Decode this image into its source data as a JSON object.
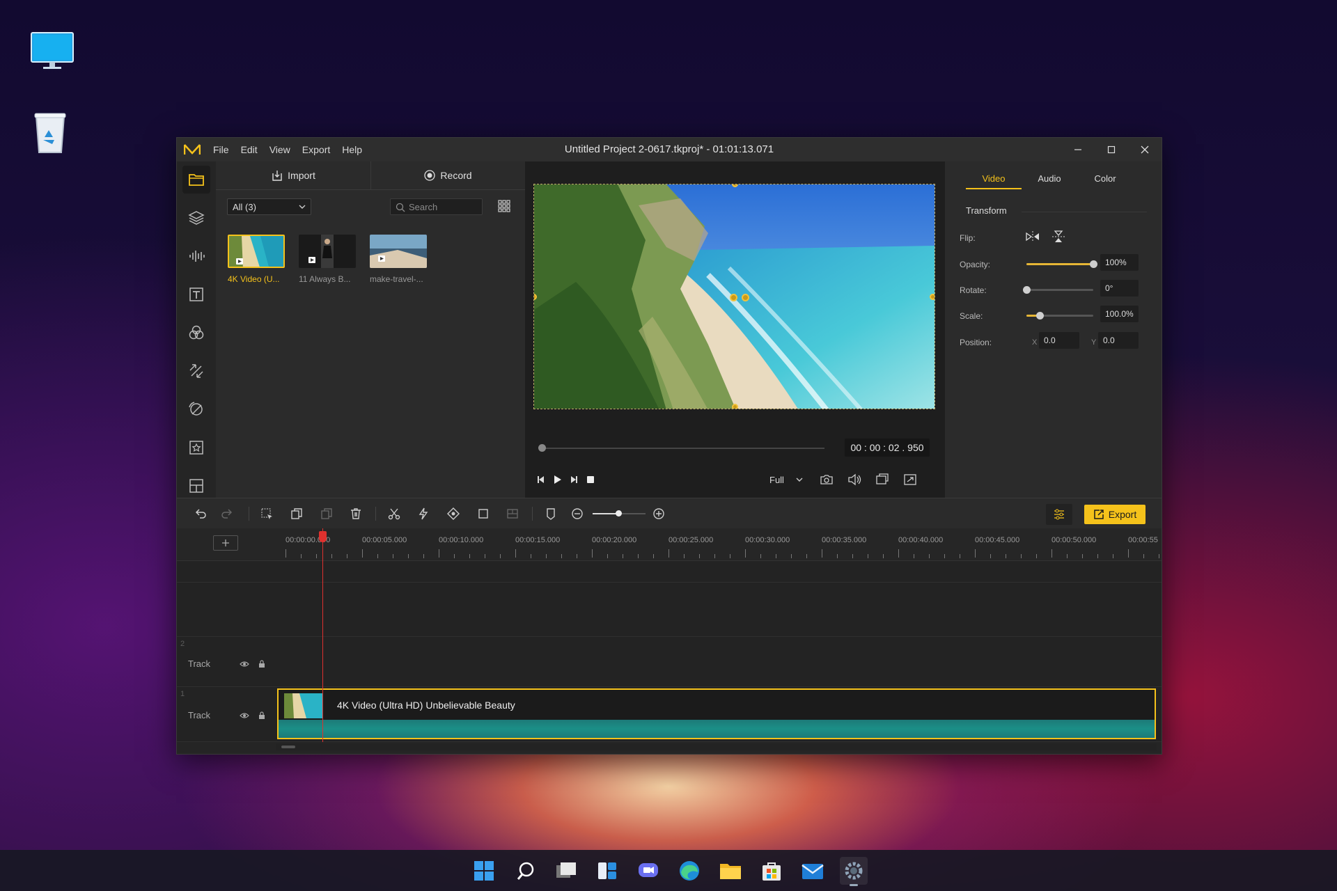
{
  "desktop": {
    "icons": [
      "monitor-icon",
      "recycle-bin-icon"
    ]
  },
  "window": {
    "title": "Untitled Project 2-0617.tkproj* - 01:01:13.071",
    "menu": [
      "File",
      "Edit",
      "View",
      "Export",
      "Help"
    ],
    "accent": "#f5c21b"
  },
  "media_panel": {
    "import_label": "Import",
    "record_label": "Record",
    "filter_value": "All (3)",
    "search_placeholder": "Search",
    "items": [
      {
        "label": "4K Video (U...",
        "selected": true
      },
      {
        "label": "11 Always B...",
        "selected": false
      },
      {
        "label": "make-travel-...",
        "selected": false
      }
    ]
  },
  "preview": {
    "timecode": "00 : 00 : 02 . 950",
    "zoom": "Full"
  },
  "properties": {
    "tabs": [
      "Video",
      "Audio",
      "Color"
    ],
    "active_tab": "Video",
    "section": "Transform",
    "flip_label": "Flip:",
    "opacity_label": "Opacity:",
    "opacity_value": "100%",
    "opacity_level": 1.0,
    "rotate_label": "Rotate:",
    "rotate_value": "0°",
    "rotate_level": 0.0,
    "scale_label": "Scale:",
    "scale_value": "100.0%",
    "scale_level": 0.2,
    "position_label": "Position:",
    "pos_x_label": "X",
    "pos_x": "0.0",
    "pos_y_label": "Y",
    "pos_y": "0.0"
  },
  "toolbar": {
    "export_label": "Export"
  },
  "timeline": {
    "ticks": [
      "00:00:00.000",
      "00:00:05.000",
      "00:00:10.000",
      "00:00:15.000",
      "00:00:20.000",
      "00:00:25.000",
      "00:00:30.000",
      "00:00:35.000",
      "00:00:40.000",
      "00:00:45.000",
      "00:00:50.000",
      "00:00:55"
    ],
    "tracks": [
      {
        "number": "2",
        "name": "Track"
      },
      {
        "number": "1",
        "name": "Track"
      }
    ],
    "clip_label": "4K Video (Ultra HD) Unbelievable Beauty"
  }
}
